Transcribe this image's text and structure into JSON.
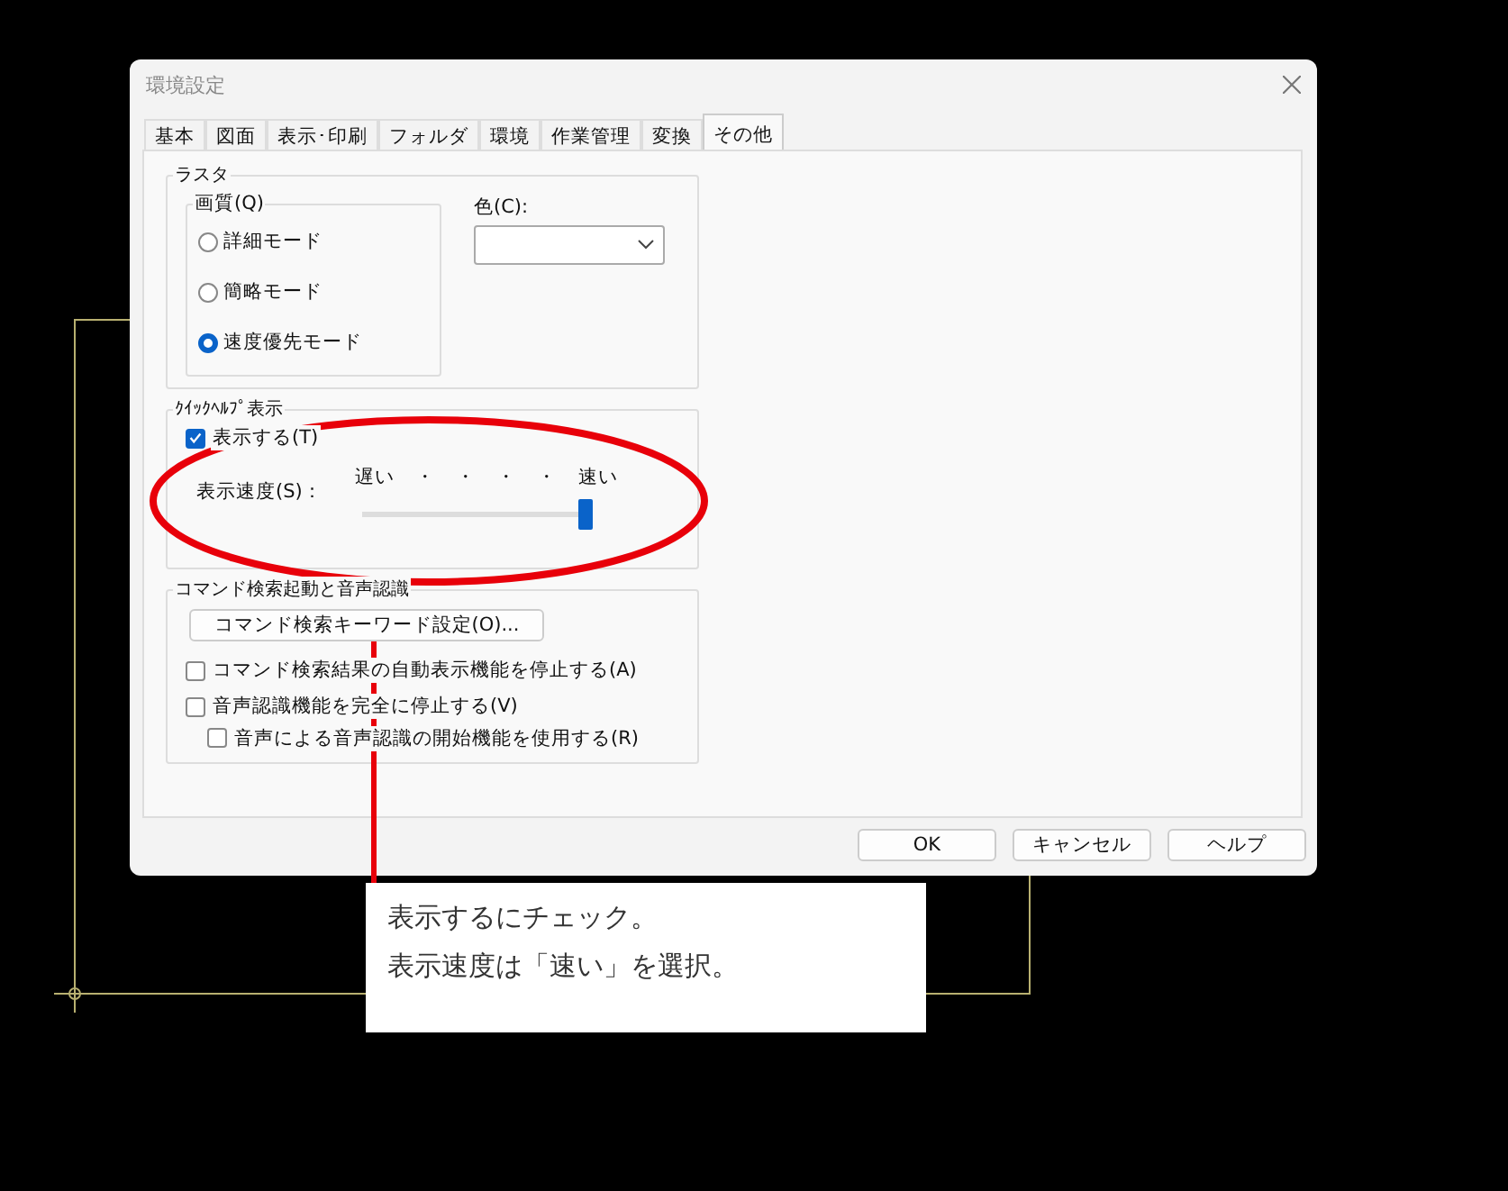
{
  "window": {
    "title": "環境設定"
  },
  "tabs": [
    {
      "label": "基本",
      "selected": false
    },
    {
      "label": "図面",
      "selected": false
    },
    {
      "label": "表示･印刷",
      "selected": false
    },
    {
      "label": "フォルダ",
      "selected": false
    },
    {
      "label": "環境",
      "selected": false
    },
    {
      "label": "作業管理",
      "selected": false
    },
    {
      "label": "変換",
      "selected": false
    },
    {
      "label": "その他",
      "selected": true
    }
  ],
  "raster": {
    "title": "ラスタ",
    "quality": {
      "title": "画質(Q)",
      "options": [
        {
          "label": "詳細モード",
          "selected": false
        },
        {
          "label": "簡略モード",
          "selected": false
        },
        {
          "label": "速度優先モード",
          "selected": true
        }
      ]
    },
    "color": {
      "label": "色(C):"
    }
  },
  "quick_help": {
    "title": "ｸｲｯｸﾍﾙﾌﾟ表示",
    "show": {
      "label": "表示する(T)",
      "checked": true
    },
    "speed": {
      "label": "表示速度(S)：",
      "slow": "遅い",
      "ticks": [
        "・",
        "・",
        "・",
        "・"
      ],
      "fast": "速い",
      "level": 1
    }
  },
  "command": {
    "title": "コマンド検索起動と音声認識",
    "button": "コマンド検索キーワード設定(O)...",
    "options": [
      {
        "label": "コマンド検索結果の自動表示機能を停止する(A)",
        "checked": false
      },
      {
        "label": "音声認識機能を完全に停止する(V)",
        "checked": false,
        "children": [
          {
            "label": "音声による音声認識の開始機能を使用する(R)",
            "checked": false
          }
        ]
      }
    ]
  },
  "buttons": [
    "OK",
    "キャンセル",
    "ヘルプ"
  ],
  "callout": {
    "lines": [
      "表示するにチェック。",
      "表示速度は「速い」を選択。"
    ]
  }
}
